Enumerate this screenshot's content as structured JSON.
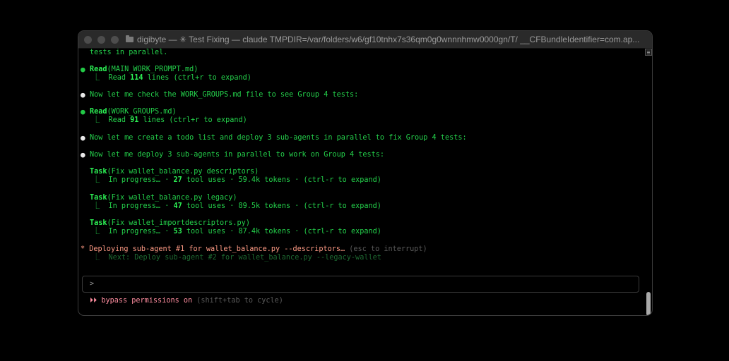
{
  "window": {
    "title": "digibyte — ✳ Test Fixing — claude TMPDIR=/var/folders/w6/gf10tnhx7s36qm0g0wnnnhmw0000gn/T/ __CFBundleIdentifier=com.ap..."
  },
  "terminal": {
    "l0": "tests in parallel.",
    "read1": {
      "tool": "Read",
      "arg": "(MAIN_WORK_PROMPT.md)",
      "pre": "⎿  Read ",
      "count": "114",
      "post": " lines (ctrl+r to expand)"
    },
    "msg1": "Now let me check the WORK_GROUPS.md file to see Group 4 tests:",
    "read2": {
      "tool": "Read",
      "arg": "(WORK_GROUPS.md)",
      "pre": "⎿  Read ",
      "count": "91",
      "post": " lines (ctrl+r to expand)"
    },
    "msg2": "Now let me create a todo list and deploy 3 sub-agents in parallel to fix Group 4 tests:",
    "msg3": "Now let me deploy 3 sub-agents in parallel to work on Group 4 tests:",
    "tasks": [
      {
        "tool": "Task",
        "arg": "(Fix wallet_balance.py descriptors)",
        "pre": "⎿  In progress… · ",
        "count": "27",
        "post": " tool uses · 59.4k tokens · (ctrl-r to expand)"
      },
      {
        "tool": "Task",
        "arg": "(Fix wallet_balance.py legacy)",
        "pre": "⎿  In progress… · ",
        "count": "47",
        "post": " tool uses · 89.5k tokens · (ctrl-r to expand)"
      },
      {
        "tool": "Task",
        "arg": "(Fix wallet_importdescriptors.py)",
        "pre": "⎿  In progress… · ",
        "count": "53",
        "post": " tool uses · 87.4k tokens · (ctrl-r to expand)"
      }
    ],
    "status": {
      "star": "*",
      "text": " Deploying sub-agent #1 for wallet_balance.py --descriptors…",
      "hint": " (esc to interrupt)"
    },
    "next": "⎿  Next: Deploy sub-agent #2 for wallet_balance.py --legacy-wallet",
    "prompt_symbol": ">",
    "mode": {
      "arrows": "⏵⏵",
      "label": " bypass permissions on",
      "hint": " (shift+tab to cycle)"
    }
  },
  "colors": {
    "accent": "#2cf054",
    "status": "#ff9b85",
    "mode": "#ff8ea0"
  }
}
